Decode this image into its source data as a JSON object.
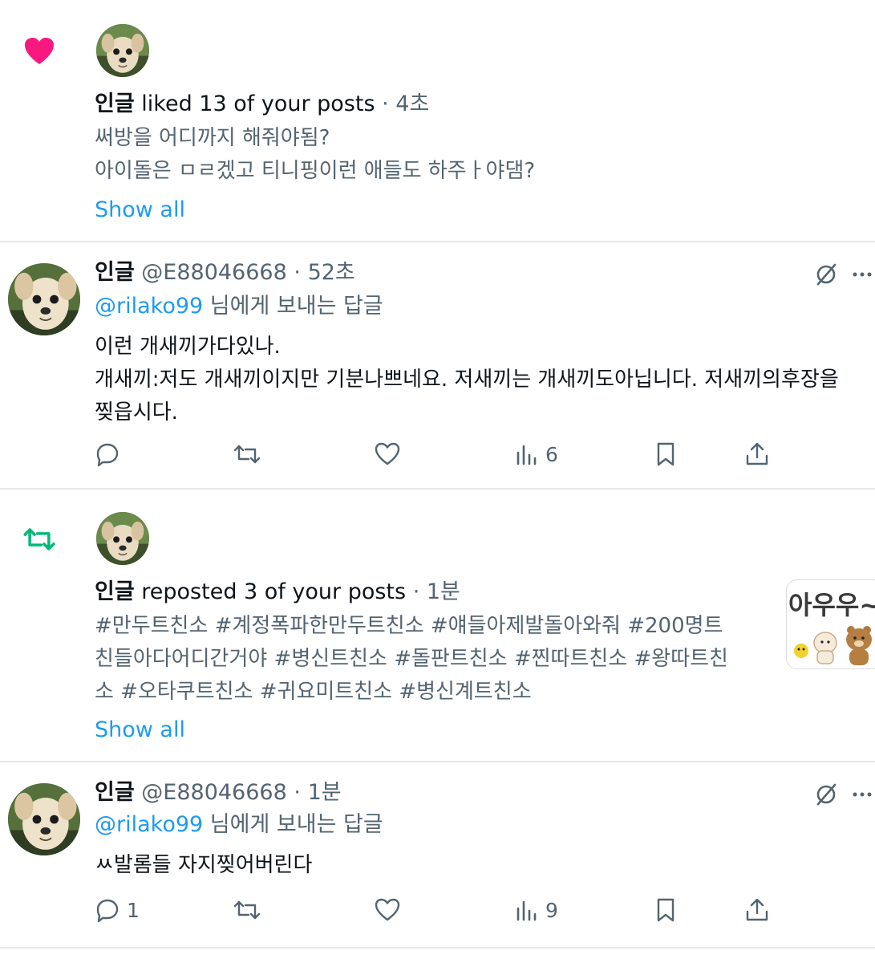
{
  "notifications": [
    {
      "type": "like",
      "gutter_icon": "heart-filled-icon",
      "icon_color": "#f91880",
      "user": "인글",
      "action": "liked 13 of your posts",
      "separator": "·",
      "time": "4초",
      "preview_lines": [
        "써방을 어디까지 해줘야됨?",
        "아이돌은 ㅁㄹ겠고 티니핑이런 애들도 하주ㅏ야댐?"
      ],
      "show_all": "Show all"
    },
    {
      "type": "reply",
      "user": "인글",
      "handle": "@E88046668",
      "separator": "·",
      "time": "52초",
      "reply_to_handle": "@rilako99",
      "reply_to_suffix": "님에게 보내는 답글",
      "text_lines": [
        "이런 개새끼가다있나.",
        "개새끼:저도 개새끼이지만 기분나쁘네요. 저새끼는 개새끼도아닙니다. 저새끼의후장을",
        "찢읍시다."
      ],
      "counts": {
        "reply": "",
        "repost": "",
        "like": "",
        "views": "6"
      },
      "top_right_icons": [
        "grok-icon",
        "more-icon"
      ]
    },
    {
      "type": "repost",
      "gutter_icon": "repost-icon",
      "icon_color": "#00ba7c",
      "user": "인글",
      "action": "reposted 3 of your posts",
      "separator": "·",
      "time": "1분",
      "preview_lines": [
        "#만두트친소 #계정폭파한만두트친소 #얘들아제발돌아와줘 #200명트",
        "친들아다어디간거야 #병신트친소 #돌판트친소 #찐따트친소 #왕따트친",
        "소 #오타쿠트친소 #귀요미트친소 #병신계트친소"
      ],
      "thumbnail_text": "아우우~",
      "show_all": "Show all"
    },
    {
      "type": "reply",
      "user": "인글",
      "handle": "@E88046668",
      "separator": "·",
      "time": "1분",
      "reply_to_handle": "@rilako99",
      "reply_to_suffix": "님에게 보내는 답글",
      "text_lines": [
        "ㅆ발롬들 자지찢어버린다"
      ],
      "counts": {
        "reply": "1",
        "repost": "",
        "like": "",
        "views": "9"
      },
      "top_right_icons": [
        "grok-icon",
        "more-icon"
      ]
    }
  ],
  "colors": {
    "text": "#0f1419",
    "muted": "#536471",
    "link": "#1d9bf0",
    "divider": "#e6e8ea"
  }
}
